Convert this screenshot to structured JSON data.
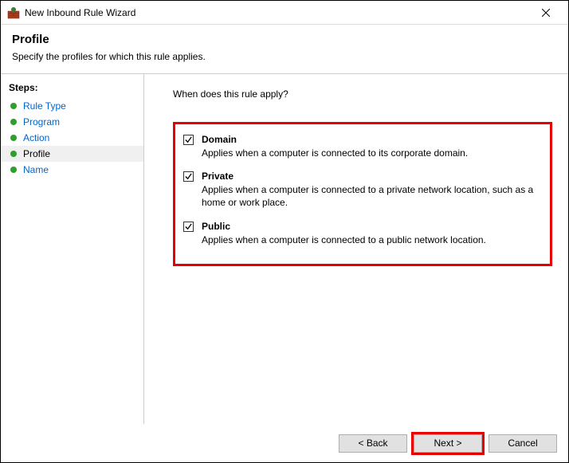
{
  "window": {
    "title": "New Inbound Rule Wizard"
  },
  "header": {
    "title": "Profile",
    "subtitle": "Specify the profiles for which this rule applies."
  },
  "sidebar": {
    "title": "Steps:",
    "items": [
      {
        "label": "Rule Type",
        "current": false
      },
      {
        "label": "Program",
        "current": false
      },
      {
        "label": "Action",
        "current": false
      },
      {
        "label": "Profile",
        "current": true
      },
      {
        "label": "Name",
        "current": false
      }
    ]
  },
  "content": {
    "question": "When does this rule apply?",
    "profiles": [
      {
        "label": "Domain",
        "checked": true,
        "description": "Applies when a computer is connected to its corporate domain."
      },
      {
        "label": "Private",
        "checked": true,
        "description": "Applies when a computer is connected to a private network location, such as a home or work place."
      },
      {
        "label": "Public",
        "checked": true,
        "description": "Applies when a computer is connected to a public network location."
      }
    ]
  },
  "footer": {
    "back": "< Back",
    "next": "Next >",
    "cancel": "Cancel"
  }
}
